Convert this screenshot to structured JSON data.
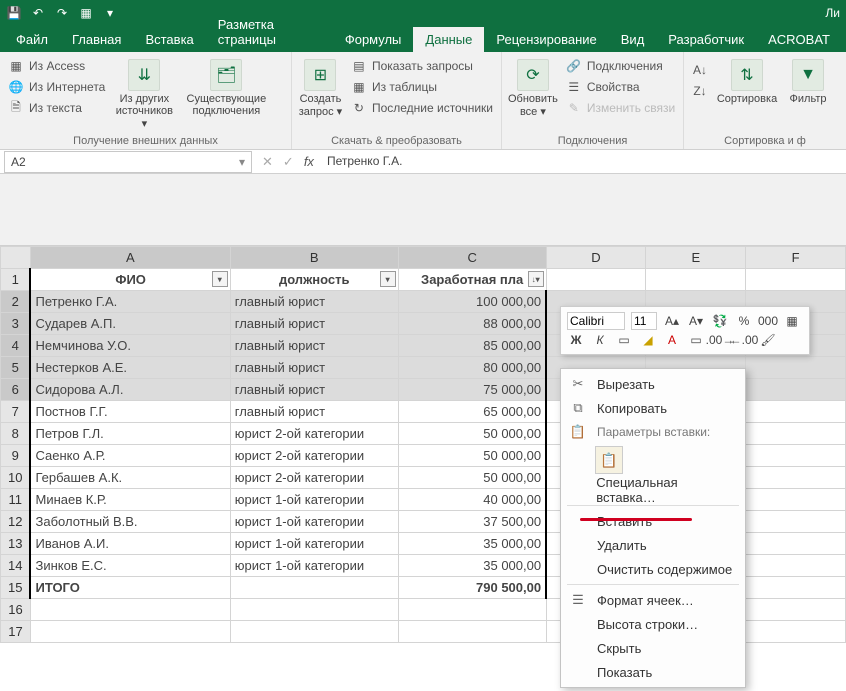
{
  "titlebar": {
    "app_hint": "Ли"
  },
  "tabs": {
    "file": "Файл",
    "home": "Главная",
    "insert": "Вставка",
    "layout": "Разметка страницы",
    "formulas": "Формулы",
    "data": "Данные",
    "review": "Рецензирование",
    "view": "Вид",
    "developer": "Разработчик",
    "acrobat": "ACROBAT"
  },
  "ribbon": {
    "ext": {
      "access": "Из Access",
      "web": "Из Интернета",
      "text": "Из текста",
      "other": "Из других источников ▾",
      "existing": "Существующие подключения",
      "label": "Получение внешних данных"
    },
    "get": {
      "newq": "Создать запрос ▾",
      "show": "Показать запросы",
      "table": "Из таблицы",
      "recent": "Последние источники",
      "label": "Скачать & преобразовать"
    },
    "conn": {
      "refresh": "Обновить все ▾",
      "conn": "Подключения",
      "props": "Свойства",
      "links": "Изменить связи",
      "label": "Подключения"
    },
    "sort": {
      "sort": "Сортировка",
      "filter": "Фильтр",
      "label": "Сортировка и ф"
    }
  },
  "namebox": "A2",
  "formula": "Петренко Г.А.",
  "columns": [
    "A",
    "B",
    "C",
    "D",
    "E",
    "F"
  ],
  "headers": {
    "fio": "ФИО",
    "pos": "должность",
    "sal": "Заработная пла"
  },
  "rows": [
    {
      "n": 2,
      "a": "Петренко Г.А.",
      "b": "главный юрист",
      "c": "100 000,00",
      "sel": true
    },
    {
      "n": 3,
      "a": "Сударев А.П.",
      "b": "главный юрист",
      "c": "88 000,00",
      "sel": true
    },
    {
      "n": 4,
      "a": "Немчинова У.О.",
      "b": "главный юрист",
      "c": "85 000,00",
      "sel": true
    },
    {
      "n": 5,
      "a": "Нестерков А.Е.",
      "b": "главный юрист",
      "c": "80 000,00",
      "sel": true
    },
    {
      "n": 6,
      "a": "Сидорова А.Л.",
      "b": "главный юрист",
      "c": "75 000,00",
      "sel": true
    },
    {
      "n": 7,
      "a": "Постнов Г.Г.",
      "b": "главный юрист",
      "c": "65 000,00"
    },
    {
      "n": 8,
      "a": "Петров Г.Л.",
      "b": "юрист 2-ой категории",
      "c": "50 000,00"
    },
    {
      "n": 9,
      "a": "Саенко А.Р.",
      "b": "юрист 2-ой категории",
      "c": "50 000,00"
    },
    {
      "n": 10,
      "a": "Гербашев А.К.",
      "b": "юрист 2-ой категории",
      "c": "50 000,00"
    },
    {
      "n": 11,
      "a": "Минаев К.Р.",
      "b": "юрист 1-ой категории",
      "c": "40 000,00"
    },
    {
      "n": 12,
      "a": "Заболотный В.В.",
      "b": "юрист 1-ой категории",
      "c": "37 500,00"
    },
    {
      "n": 13,
      "a": "Иванов А.И.",
      "b": "юрист 1-ой категории",
      "c": "35 000,00"
    },
    {
      "n": 14,
      "a": "Зинков Е.С.",
      "b": "юрист 1-ой категории",
      "c": "35 000,00"
    }
  ],
  "total": {
    "n": 15,
    "a": "ИТОГО",
    "b": "",
    "c": "790 500,00"
  },
  "mini": {
    "font": "Calibri",
    "size": "11",
    "bold": "Ж",
    "italic": "К"
  },
  "ctx": {
    "cut": "Вырезать",
    "copy": "Копировать",
    "paste_opts": "Параметры вставки:",
    "paste_special": "Специальная вставка…",
    "insert": "Вставить",
    "delete": "Удалить",
    "clear": "Очистить содержимое",
    "format": "Формат ячеек…",
    "rowh": "Высота строки…",
    "hide": "Скрыть",
    "show": "Показать"
  }
}
